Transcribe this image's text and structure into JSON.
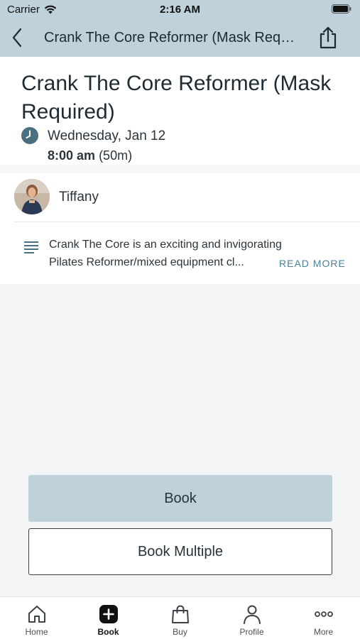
{
  "status_bar": {
    "carrier": "Carrier",
    "time": "2:16 AM"
  },
  "nav": {
    "title": "Crank The Core Reformer (Mask Requ..."
  },
  "class": {
    "title": "Crank The Core Reformer (Mask Required)",
    "date": "Wednesday, Jan 12",
    "time": "8:00 am",
    "duration": "(50m)"
  },
  "instructor": {
    "name": "Tiffany"
  },
  "description": {
    "line1": "Crank The Core is an exciting and invigorating",
    "line2": "Pilates Reformer/mixed equipment cl...",
    "read_more": "READ MORE"
  },
  "actions": {
    "book": "Book",
    "book_multiple": "Book Multiple"
  },
  "tabs": [
    {
      "label": "Home",
      "icon": "home-icon"
    },
    {
      "label": "Book",
      "icon": "plus-square-icon"
    },
    {
      "label": "Buy",
      "icon": "shopping-bag-icon"
    },
    {
      "label": "Profile",
      "icon": "person-icon"
    },
    {
      "label": "More",
      "icon": "more-dots-icon"
    }
  ],
  "colors": {
    "header_bg": "#bfd1da",
    "accent": "#4b8097",
    "clock": "#4a6f80"
  }
}
